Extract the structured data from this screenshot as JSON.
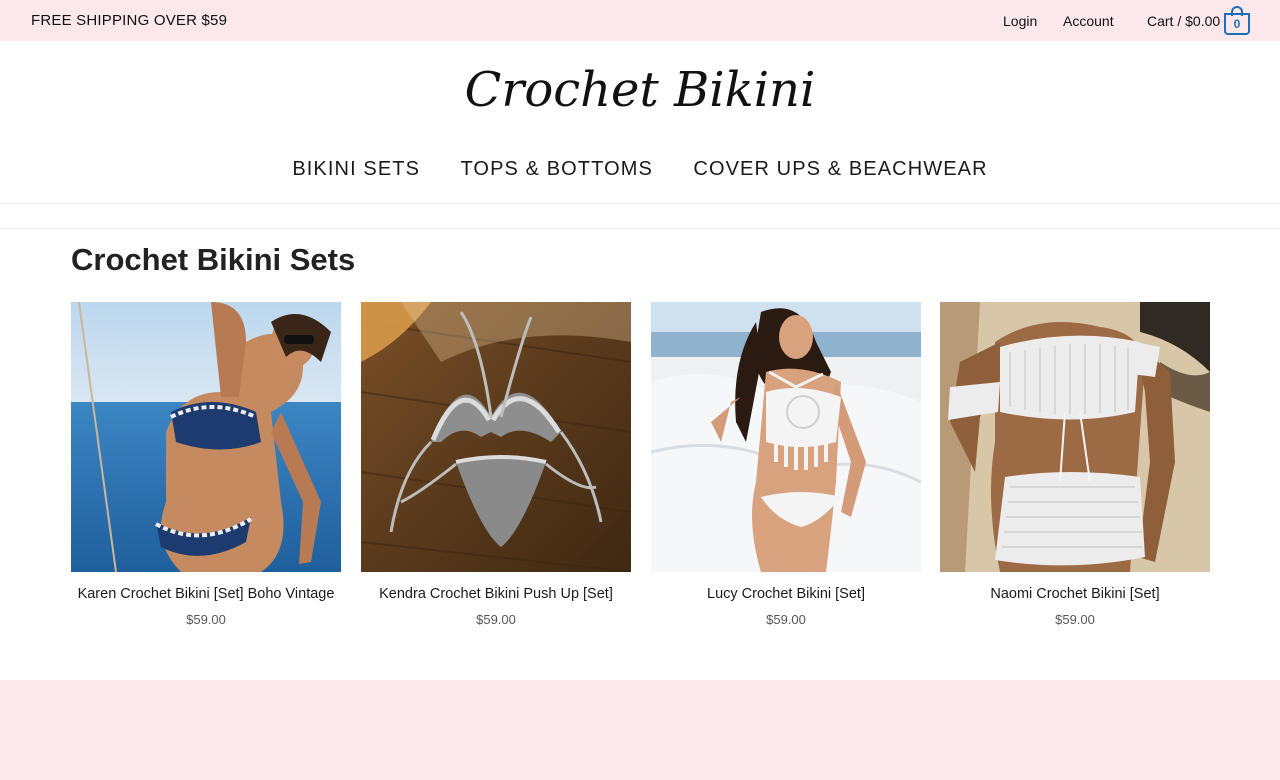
{
  "topbar": {
    "promo": "FREE SHIPPING OVER $59",
    "login": "Login",
    "account": "Account",
    "cart_label": "Cart / $0.00",
    "cart_count": "0"
  },
  "logo": {
    "text": "Crochet Bikini"
  },
  "nav": {
    "items": [
      "BIKINI SETS",
      "TOPS & BOTTOMS",
      "COVER UPS & BEACHWEAR"
    ]
  },
  "main": {
    "title": "Crochet Bikini Sets"
  },
  "products": [
    {
      "name": "Karen Crochet Bikini [Set] Boho Vintage",
      "price": "$59.00"
    },
    {
      "name": "Kendra Crochet Bikini Push Up [Set]",
      "price": "$59.00"
    },
    {
      "name": "Lucy Crochet Bikini [Set]",
      "price": "$59.00"
    },
    {
      "name": "Naomi Crochet Bikini [Set]",
      "price": "$59.00"
    }
  ],
  "colors": {
    "topbar_bg": "#fce7ea",
    "cart_accent": "#1e6fb8",
    "footer_bg": "#fce7ea"
  },
  "icons": {
    "cart": "shopping-bag-icon"
  }
}
